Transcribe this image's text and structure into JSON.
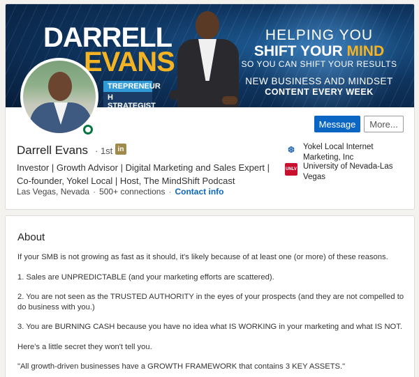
{
  "banner": {
    "name_first": "DARRELL",
    "name_last": "EVANS",
    "tag1": "TREPRENEUR",
    "tag2": "H STRATEGIST",
    "tagline1": "HELPING YOU",
    "tagline2_a": "SHIFT YOUR ",
    "tagline2_b": "MIND",
    "tagline3": "SO YOU CAN SHIFT YOUR RESULTS",
    "tagline4": "NEW BUSINESS AND MINDSET",
    "tagline5": "CONTENT EVERY WEEK"
  },
  "actions": {
    "message": "Message",
    "more": "More..."
  },
  "profile": {
    "name": "Darrell Evans",
    "degree": "· 1st",
    "badge": "in",
    "headline": "Investor | Growth Advisor | Digital Marketing and Sales Expert | Co-founder, Yokel Local | Host, The MindShift Podcast",
    "location": "Las Vegas, Nevada",
    "connections": "500+ connections",
    "contact": "Contact info",
    "sep": "·"
  },
  "orgs": [
    {
      "name": "Yokel Local Internet Marketing, Inc",
      "logo": "yokel-logo-icon"
    },
    {
      "name": "University of Nevada-Las Vegas",
      "logo": "unlv-logo-icon",
      "logo_text": "UNLV"
    }
  ],
  "about": {
    "title": "About",
    "p1": "If your SMB is not growing as fast as it should, it's likely because of at least one (or more) of these reasons.",
    "p2": "1. Sales are UNPREDICTABLE (and your marketing efforts are scattered).",
    "p3": "2. You are not seen as the TRUSTED AUTHORITY in the eyes of your prospects (and they are not compelled to do business with you.)",
    "p4": "3. You are BURNING CASH because you have no idea what IS WORKING in your marketing and what IS NOT.",
    "p5": "Here's a little secret they won't tell you.",
    "p6": "\"All growth-driven businesses have a GROWTH FRAMEWORK that contains 3 KEY ASSETS.\""
  },
  "colors": {
    "accent": "#0a66c2",
    "banner_gold": "#f4b323",
    "online": "#057642"
  }
}
